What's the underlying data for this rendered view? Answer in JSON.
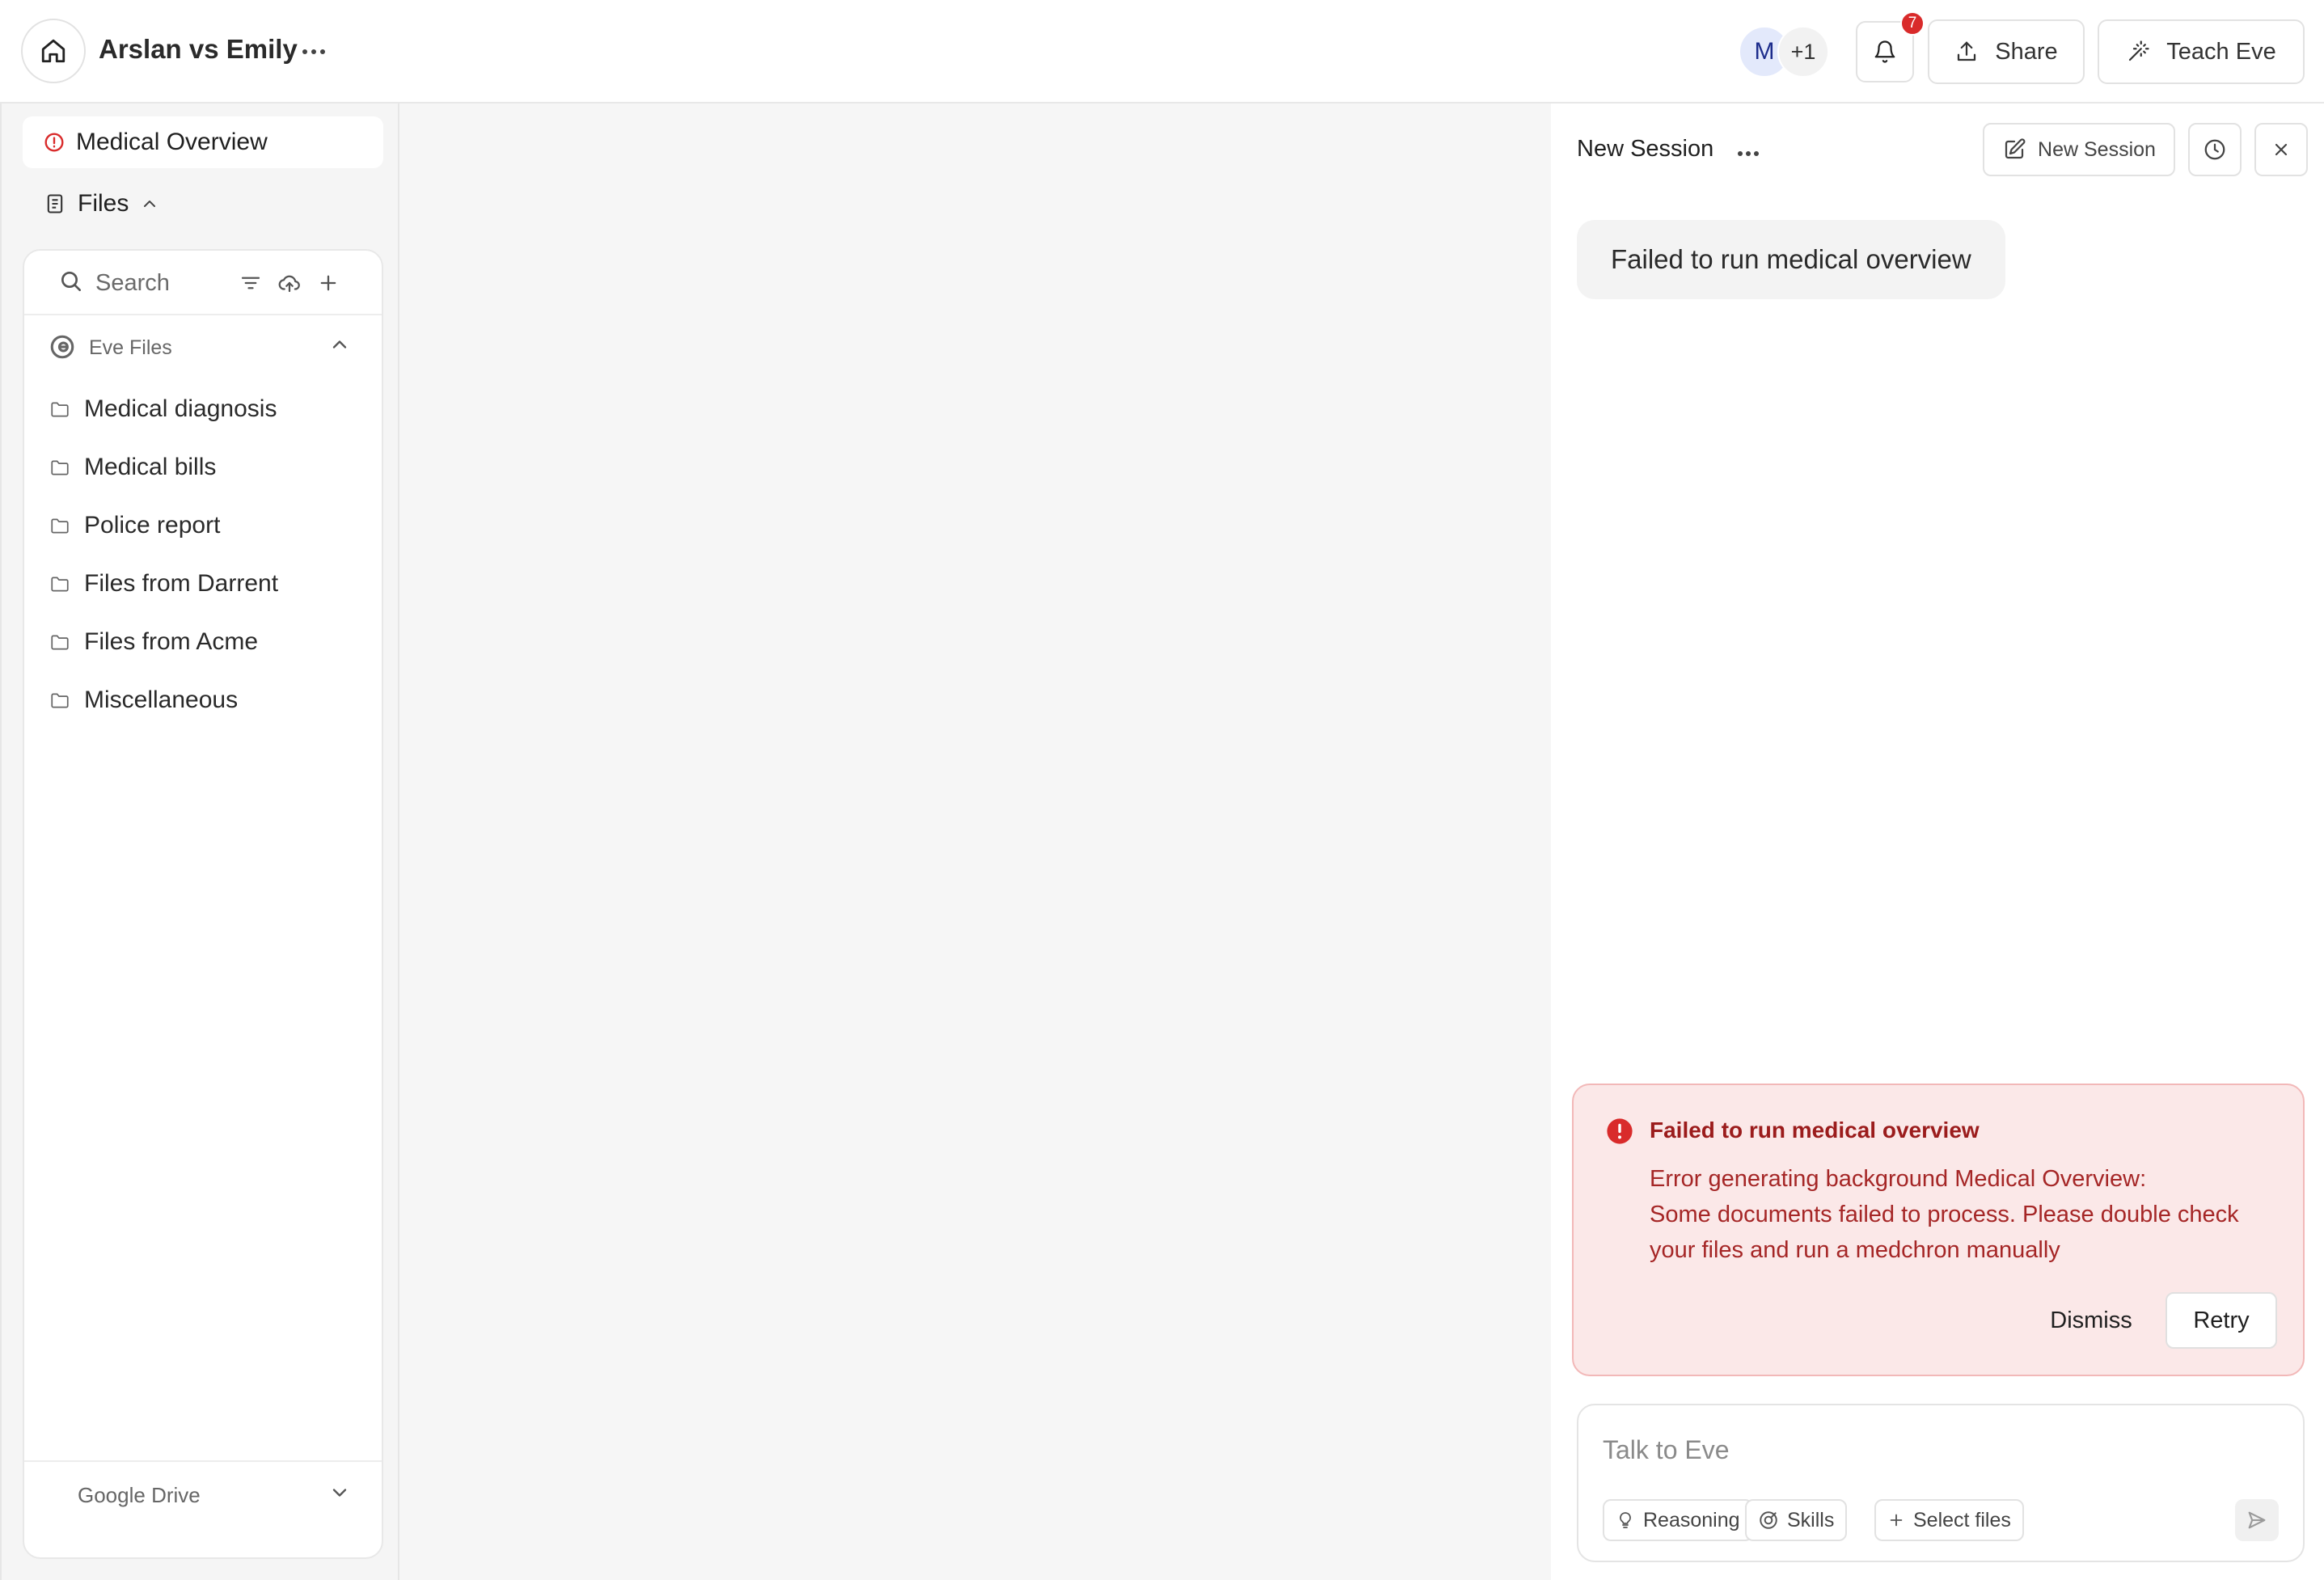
{
  "header": {
    "case_title": "Arslan vs Emily",
    "avatar_initial": "M",
    "avatar_more": "+1",
    "notification_count": "7",
    "share_label": "Share",
    "teach_label": "Teach Eve"
  },
  "sidebar": {
    "medical_overview_label": "Medical Overview",
    "files_label": "Files",
    "search_placeholder": "Search",
    "eve_files_label": "Eve Files",
    "folders": [
      "Medical diagnosis",
      "Medical bills",
      "Police report",
      "Files from Darrent",
      "Files from Acme",
      "Miscellaneous"
    ],
    "google_drive_label": "Google Drive"
  },
  "session": {
    "title": "New Session",
    "new_session_label": "New Session",
    "message": "Failed to run medical overview"
  },
  "error": {
    "title": "Failed to run medical overview",
    "body_line1": "Error generating background Medical Overview:",
    "body_line2": "Some documents failed to process. Please double check your files and run a medchron manually",
    "dismiss_label": "Dismiss",
    "retry_label": "Retry"
  },
  "composer": {
    "placeholder": "Talk to Eve",
    "reasoning_label": "Reasoning",
    "skills_label": "Skills",
    "select_files_label": "Select files"
  },
  "colors": {
    "error_red": "#d92b2b",
    "error_bg": "#fbe8e8",
    "avatar_bg": "#e3e9fb"
  }
}
